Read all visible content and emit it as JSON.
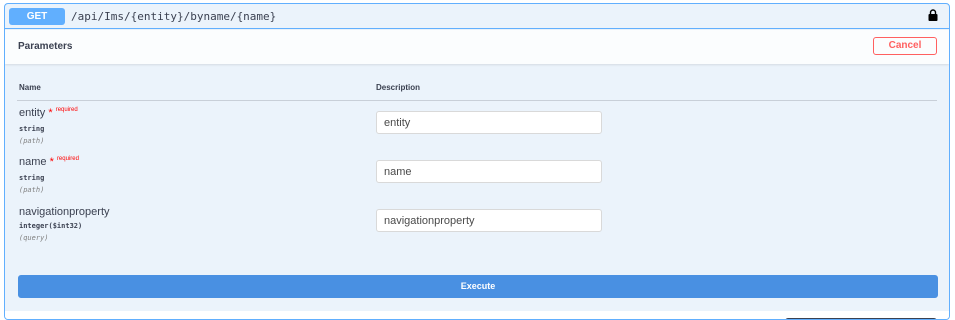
{
  "operation": {
    "method": "GET",
    "path": "/api/Ims/{entity}/byname/{name}",
    "lock_icon": "lock-icon",
    "accent_color": "#61affe"
  },
  "parameters_section": {
    "title": "Parameters",
    "cancel_label": "Cancel"
  },
  "table": {
    "col_name": "Name",
    "col_description": "Description"
  },
  "params": [
    {
      "name": "entity",
      "required_mark": "*",
      "required_label": "required",
      "type": "string",
      "in": "(path)",
      "placeholder": "entity"
    },
    {
      "name": "name",
      "required_mark": "*",
      "required_label": "required",
      "type": "string",
      "in": "(path)",
      "placeholder": "name"
    },
    {
      "name": "navigationproperty",
      "type": "integer($int32)",
      "in": "(query)",
      "placeholder": "navigationproperty"
    }
  ],
  "execute_label": "Execute",
  "colors": {
    "execute": "#4990e2",
    "cancel": "#ff6060",
    "required": "#ff0000"
  }
}
